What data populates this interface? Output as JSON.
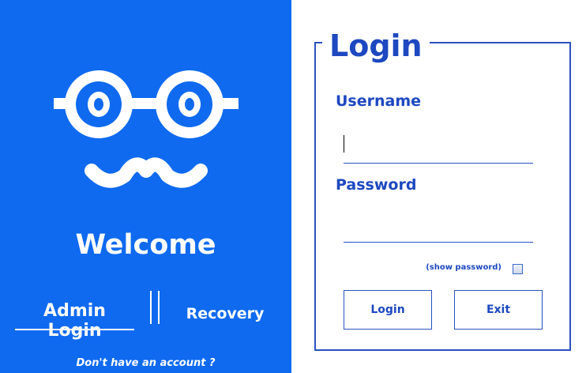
{
  "left_panel": {
    "bg_color": "#0f6af0",
    "mascot_icon": "glasses-mustache-icon",
    "welcome": "Welcome",
    "nav": {
      "admin_login": "Admin Login",
      "recovery": "Recovery"
    },
    "signup_link": "Don't have an account ?"
  },
  "login_form": {
    "title": "Login",
    "accent_color": "#1d48c0",
    "username": {
      "label": "Username",
      "value": "",
      "placeholder": ""
    },
    "password": {
      "label": "Password",
      "value": "",
      "placeholder": ""
    },
    "show_password": {
      "label": "(show password)",
      "checked": false
    },
    "buttons": {
      "login": "Login",
      "exit": "Exit"
    }
  }
}
